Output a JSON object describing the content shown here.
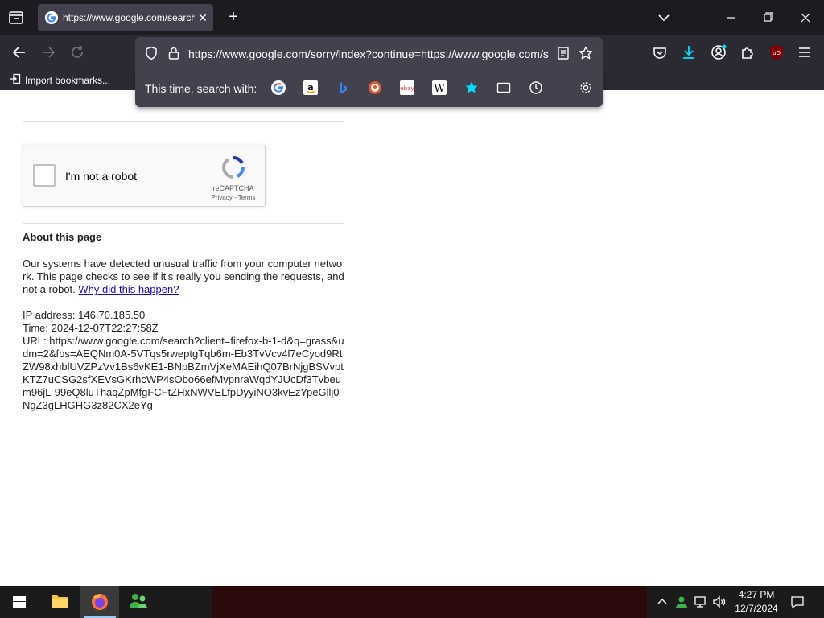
{
  "browser": {
    "tab": {
      "title": "https://www.google.com/search",
      "close_glyph": "✕"
    },
    "new_tab_glyph": "+",
    "urlbar": {
      "url": "https://www.google.com/sorry/index?continue=https://www.google.com/s"
    },
    "bookmarks": {
      "import_label": "Import bookmarks..."
    },
    "search_panel": {
      "label": "This time, search with:",
      "engines": [
        "google-icon",
        "amazon-icon",
        "bing-icon",
        "duckduckgo-icon",
        "ebay-icon",
        "wikipedia-icon",
        "bookmarks-star-icon",
        "tabs-icon",
        "history-icon"
      ]
    }
  },
  "page": {
    "captcha": {
      "label": "I'm not a robot",
      "brand": "reCAPTCHA",
      "links": "Privacy - Terms"
    },
    "about_title": "About this page",
    "para1": "Our systems have detected unusual traffic from your computer network. This page checks to see if it's really you sending the requests, and not a robot.",
    "why_link": "Why did this happen?",
    "ip": "IP address: 146.70.185.50",
    "time": "Time: 2024-12-07T22:27:58Z",
    "url": "URL: https://www.google.com/search?client=firefox-b-1-d&q=grass&udm=2&fbs=AEQNm0A-5VTqs5rweptgTqb6m-Eb3TvVcv4l7eCyod9RtZW98xhblUVZPzVv1Bs6vKE1-BNpBZmVjXeMAEihQ07BrNjgBSVvptKTZ7uCSG2sfXEVsGKrhcWP4sObo66efMvpnraWqdYJUcDf3Tvbeum96jL-99eQ8luThaqZpMfgFCFtZHxNWVELfpDyyiNO3kvEzYpeGllj0NgZ3gLHGHG3z82CX2eYg"
  },
  "taskbar": {
    "time": "4:27 PM",
    "date": "12/7/2024"
  },
  "colors": {
    "tabstrip": "#1c1b22",
    "toolbar": "#2b2a33",
    "urlbar": "#42414d",
    "link": "#1a0dab",
    "accent_download": "#00ddff",
    "ublock": "#800000"
  }
}
